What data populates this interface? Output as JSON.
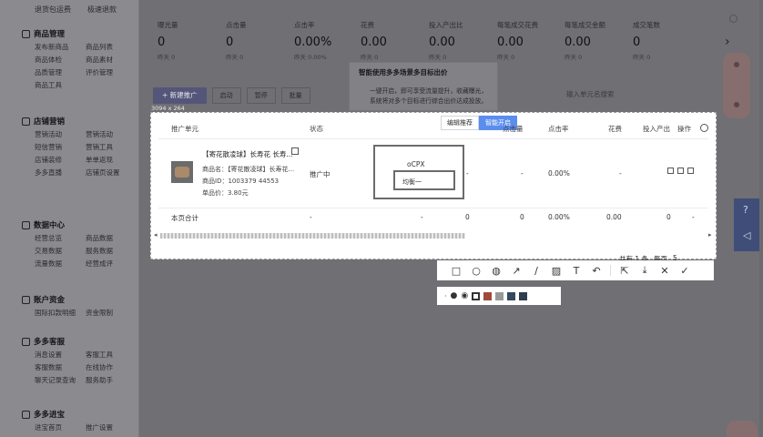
{
  "sidebar": {
    "top_links": [
      "退货包运费",
      "极速退款"
    ],
    "sections": [
      {
        "title": "商品管理",
        "items": [
          "发布新商品",
          "商品列表",
          "商品体检",
          "商品素材",
          "品质管理",
          "评价管理",
          "商品工具"
        ]
      },
      {
        "title": "店铺营销",
        "items": [
          "营销活动",
          "营销活动",
          "短信营销",
          "营销工具",
          "店铺装修",
          "单单返现",
          "多多直播",
          "店铺页设置"
        ]
      },
      {
        "title": "数据中心",
        "items": [
          "经营总览",
          "商品数据",
          "交易数据",
          "服务数据",
          "流量数据",
          "经营成评"
        ]
      },
      {
        "title": "账户资金",
        "items": [
          "国际扣款明细",
          "资金限制"
        ]
      },
      {
        "title": "多多客服",
        "items": [
          "消息设置",
          "客服工具",
          "客服数据",
          "在线协作",
          "聊天记录查询",
          "服务助手"
        ]
      },
      {
        "title": "多多进宝",
        "items": [
          "进宝首页",
          "推广设置"
        ]
      }
    ]
  },
  "stats": [
    {
      "label": "曝光量",
      "value": "0",
      "sub": "昨天 0"
    },
    {
      "label": "点击量",
      "value": "0",
      "sub": "昨天 0"
    },
    {
      "label": "点击率",
      "value": "0.00%",
      "sub": "昨天 0.00%"
    },
    {
      "label": "花费",
      "value": "0.00",
      "sub": "昨天 0"
    },
    {
      "label": "投入产出比",
      "value": "0.00",
      "sub": "昨天 0"
    },
    {
      "label": "每笔成交花费",
      "value": "0.00",
      "sub": "昨天 0"
    },
    {
      "label": "每笔成交金额",
      "value": "0.00",
      "sub": "昨天 0"
    },
    {
      "label": "成交笔数",
      "value": "0",
      "sub": "昨天 0"
    }
  ],
  "tooltip": {
    "title": "智能使用多多场景多目标出价",
    "body": "一键开启，即可享受流量提升，收藏曝光，\n系统将对多个目标进行综合出价达成投放。"
  },
  "actions": {
    "primary": "+ 新建推广",
    "ghost": [
      "启动",
      "暂停",
      "批量"
    ],
    "search_placeholder": "输入单元名搜索"
  },
  "capture_size": "3094 x 264",
  "table": {
    "tabs": [
      "编辑推荐",
      "智能开启"
    ],
    "headers": {
      "unit": "推广单元",
      "status": "状态",
      "impressions": "点击量",
      "ctr": "点击率",
      "spend": "花费",
      "roi": "投入产出",
      "ops": "操作"
    },
    "row": {
      "name": "【寄花散凌球】长寿花 长寿...",
      "shop": "商品名：【寄花散凌球】长寿花...",
      "id": "商品ID：1003379 44553",
      "price": "单品价：3.80元",
      "status": "推广中",
      "bid_mode": "oCPX",
      "bid_select": "均衡一",
      "dash1": "-",
      "dash2": "-",
      "ctr": "0.00%",
      "dash3": "-"
    },
    "total": {
      "label": "本页合计",
      "dash1": "-",
      "dash2": "-",
      "v1": "0",
      "v2": "0",
      "ctr": "0.00%",
      "spend": "0.00",
      "v3": "0",
      "dash3": "-"
    }
  },
  "pager": {
    "text": "共有 1 条",
    "per": "每页",
    "size": "5"
  },
  "snap_tools": [
    "rect-tool",
    "ellipse-tool",
    "mosaic-tool",
    "arrow-tool",
    "pen-tool",
    "marker-tool",
    "text-tool",
    "undo-tool",
    "pin-tool",
    "download-tool",
    "cancel-tool",
    "confirm-tool"
  ],
  "snap_colors": [
    "#ffffff",
    "#c0392b",
    "#999999",
    "#34495e",
    "#2c3e50"
  ]
}
